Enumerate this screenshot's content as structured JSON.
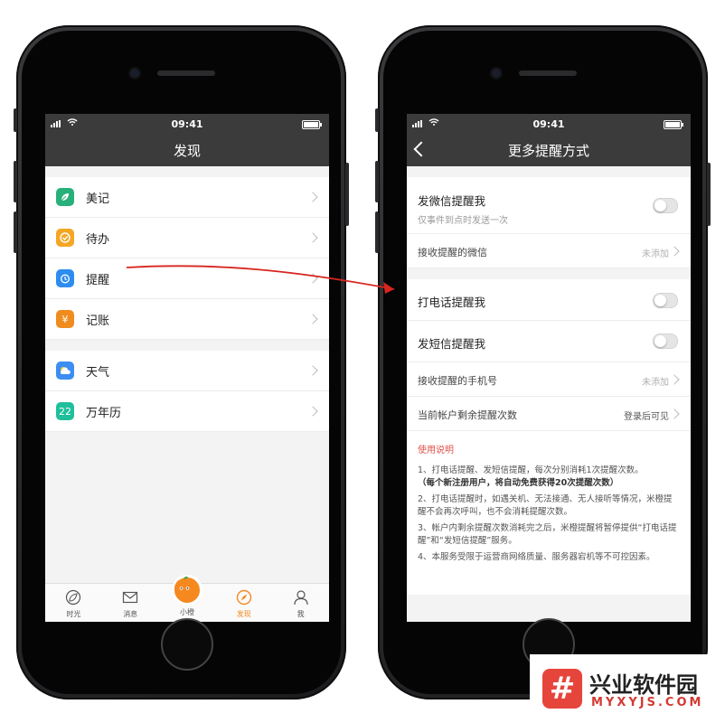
{
  "left_phone": {
    "status": {
      "time": "09:41"
    },
    "nav_title": "发现",
    "group1": [
      {
        "label": "美记",
        "icon": "leaf-icon",
        "color": "#27b07a"
      },
      {
        "label": "待办",
        "icon": "check-icon",
        "color": "#f5a623"
      },
      {
        "label": "提醒",
        "icon": "alarm-clock-icon",
        "color": "#2d8cf0"
      },
      {
        "label": "记账",
        "icon": "yuan-icon",
        "color": "#f08c1f"
      }
    ],
    "group2": [
      {
        "label": "天气",
        "icon": "cloud-icon",
        "color": "#3c8ef3"
      },
      {
        "label": "万年历",
        "icon": "calendar-icon",
        "color": "#1fbf9b",
        "icon_text": "22"
      }
    ],
    "tabs": [
      {
        "label": "时光",
        "icon": "leaf-outline-icon"
      },
      {
        "label": "消息",
        "icon": "mail-icon"
      },
      {
        "label": "小橙",
        "icon": "orange-mascot-icon"
      },
      {
        "label": "发现",
        "icon": "compass-icon",
        "active": true
      },
      {
        "label": "我",
        "icon": "person-icon"
      }
    ]
  },
  "right_phone": {
    "status": {
      "time": "09:41"
    },
    "nav_title": "更多提醒方式",
    "wechat": {
      "title": "发微信提醒我",
      "subtitle": "仅事件到点时发送一次",
      "receive_label": "接收提醒的微信",
      "receive_value": "未添加"
    },
    "phone_call": {
      "title": "打电话提醒我"
    },
    "sms": {
      "title": "发短信提醒我"
    },
    "receive_phone": {
      "label": "接收提醒的手机号",
      "value": "未添加"
    },
    "remaining": {
      "label": "当前帐户剩余提醒次数",
      "value": "登录后可见"
    },
    "notes": {
      "title": "使用说明",
      "p1": "1、打电话提醒、发短信提醒，每次分别消耗1次提醒次数。",
      "p1b": "（每个新注册用户，将自动免费获得20次提醒次数）",
      "p2": "2、打电话提醒时，如遇关机、无法接通、无人接听等情况，米橙提醒不会再次呼叫，也不会消耗提醒次数。",
      "p3": "3、帐户内剩余提醒次数消耗完之后，米橙提醒将暂停提供“打电话提醒”和“发短信提醒”服务。",
      "p4": "4、本服务受限于运营商网络质量、服务器宕机等不可控因素。"
    }
  },
  "watermark": {
    "brand": "兴业软件园",
    "domain": "MYXYJS.COM",
    "mark": "#"
  },
  "colors": {
    "accent": "#f5891f",
    "nav": "#3b3b3b",
    "arrow": "#d8261f",
    "notes_title": "#e0504a"
  }
}
